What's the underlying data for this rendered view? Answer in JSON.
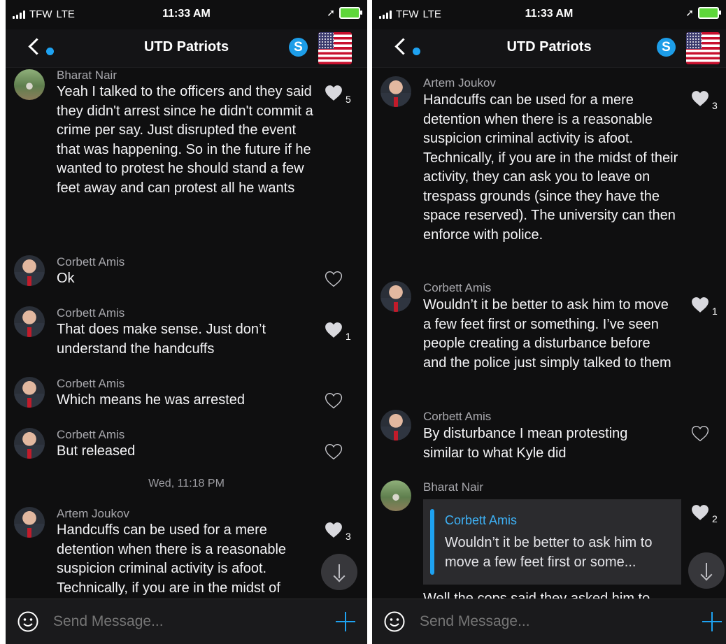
{
  "status_bar": {
    "carrier": "TFW",
    "network": "LTE",
    "time": "11:33 AM"
  },
  "chat": {
    "title": "UTD Patriots",
    "skype_letter": "S"
  },
  "left_screen": {
    "messages": [
      {
        "sender": "Bharat Nair",
        "text": "Yeah I talked to the officers and they said they didn't arrest since he didn't commit a crime per say. Just disrupted the event that was happening. So in the future if he wanted to protest he should stand a few feet away and can protest all he wants",
        "likes": "5"
      },
      {
        "sender": "Corbett Amis",
        "text": "Ok",
        "likes": ""
      },
      {
        "sender": "Corbett Amis",
        "text": "That does make sense. Just don’t understand the handcuffs",
        "likes": "1"
      },
      {
        "sender": "Corbett Amis",
        "text": "Which means he was arrested",
        "likes": ""
      },
      {
        "sender": "Corbett Amis",
        "text": "But released",
        "likes": ""
      },
      {
        "sender": "Artem Joukov",
        "text": "Handcuffs can be used for a mere detention when there is a reasonable suspicion criminal activity is afoot. Technically, if you are in the midst of",
        "likes": "3"
      }
    ],
    "date_separator": "Wed, 11:18 PM"
  },
  "right_screen": {
    "messages": [
      {
        "sender": "Artem Joukov",
        "text": "Handcuffs can be used for a mere detention when there is a reasonable suspicion criminal activity is afoot. Technically, if you are in the midst of their activity, they can ask you to leave on trespass grounds (since they have the space reserved). The university can then enforce with police.",
        "likes": "3"
      },
      {
        "sender": "Corbett Amis",
        "text": "Wouldn’t it be better to ask him to move a few feet first or something. I’ve seen people creating a disturbance before and the police just simply talked to them",
        "likes": "1"
      },
      {
        "sender": "Corbett Amis",
        "text": "By disturbance I mean protesting similar to what Kyle did",
        "likes": ""
      },
      {
        "sender": "Bharat Nair",
        "quote_sender": "Corbett Amis",
        "quote_text": "Wouldn’t it be better to ask him to move a few feet first or some...",
        "text": "Well the cops said they asked him to",
        "likes": "2"
      }
    ]
  },
  "composer": {
    "placeholder": "Send Message..."
  },
  "colors": {
    "accent": "#1ea2f1",
    "background": "#0f0f10",
    "liked_heart": "#d9d9de",
    "unliked_heart": "#c7c7cc"
  },
  "icons": {
    "back": "chevron-left-icon",
    "skype": "skype-icon",
    "flag": "us-flag-icon",
    "like": "heart-icon",
    "emoji": "smiley-icon",
    "add": "plus-icon",
    "scroll": "arrow-down-icon"
  }
}
